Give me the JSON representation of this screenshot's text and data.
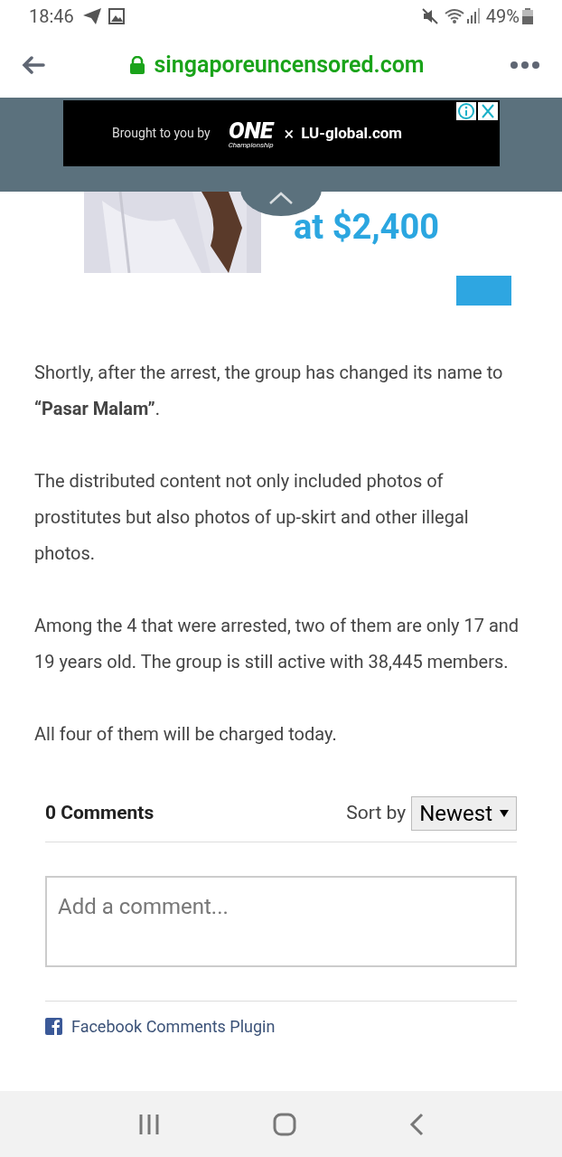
{
  "status_bar": {
    "time": "18:46",
    "battery": "49%"
  },
  "browser": {
    "url": "singaporeuncensored.com"
  },
  "sticky_ad": {
    "lead": "Brought to you by",
    "brand": "ONE",
    "brand_sub": "Championship",
    "times": "×",
    "partner": "LU-global.com"
  },
  "ad_image": {
    "price": "at $2,400"
  },
  "paragraphs": [
    "Shortly, after the arrest, the group has changed its name to **“Pasar Malam”**.",
    "The distributed content not only included photos of prostitutes but also photos of up-skirt and other illegal photos.",
    "Among the 4 that were arrested, two of them are only 17 and 19 years old. The group is still active with 38,445 members.",
    "All four of them will be charged today."
  ],
  "comments": {
    "count": "0 Comments",
    "sort_label": "Sort by",
    "sort_value": "Newest",
    "placeholder": "Add a comment...",
    "plugin": "Facebook Comments Plugin"
  }
}
